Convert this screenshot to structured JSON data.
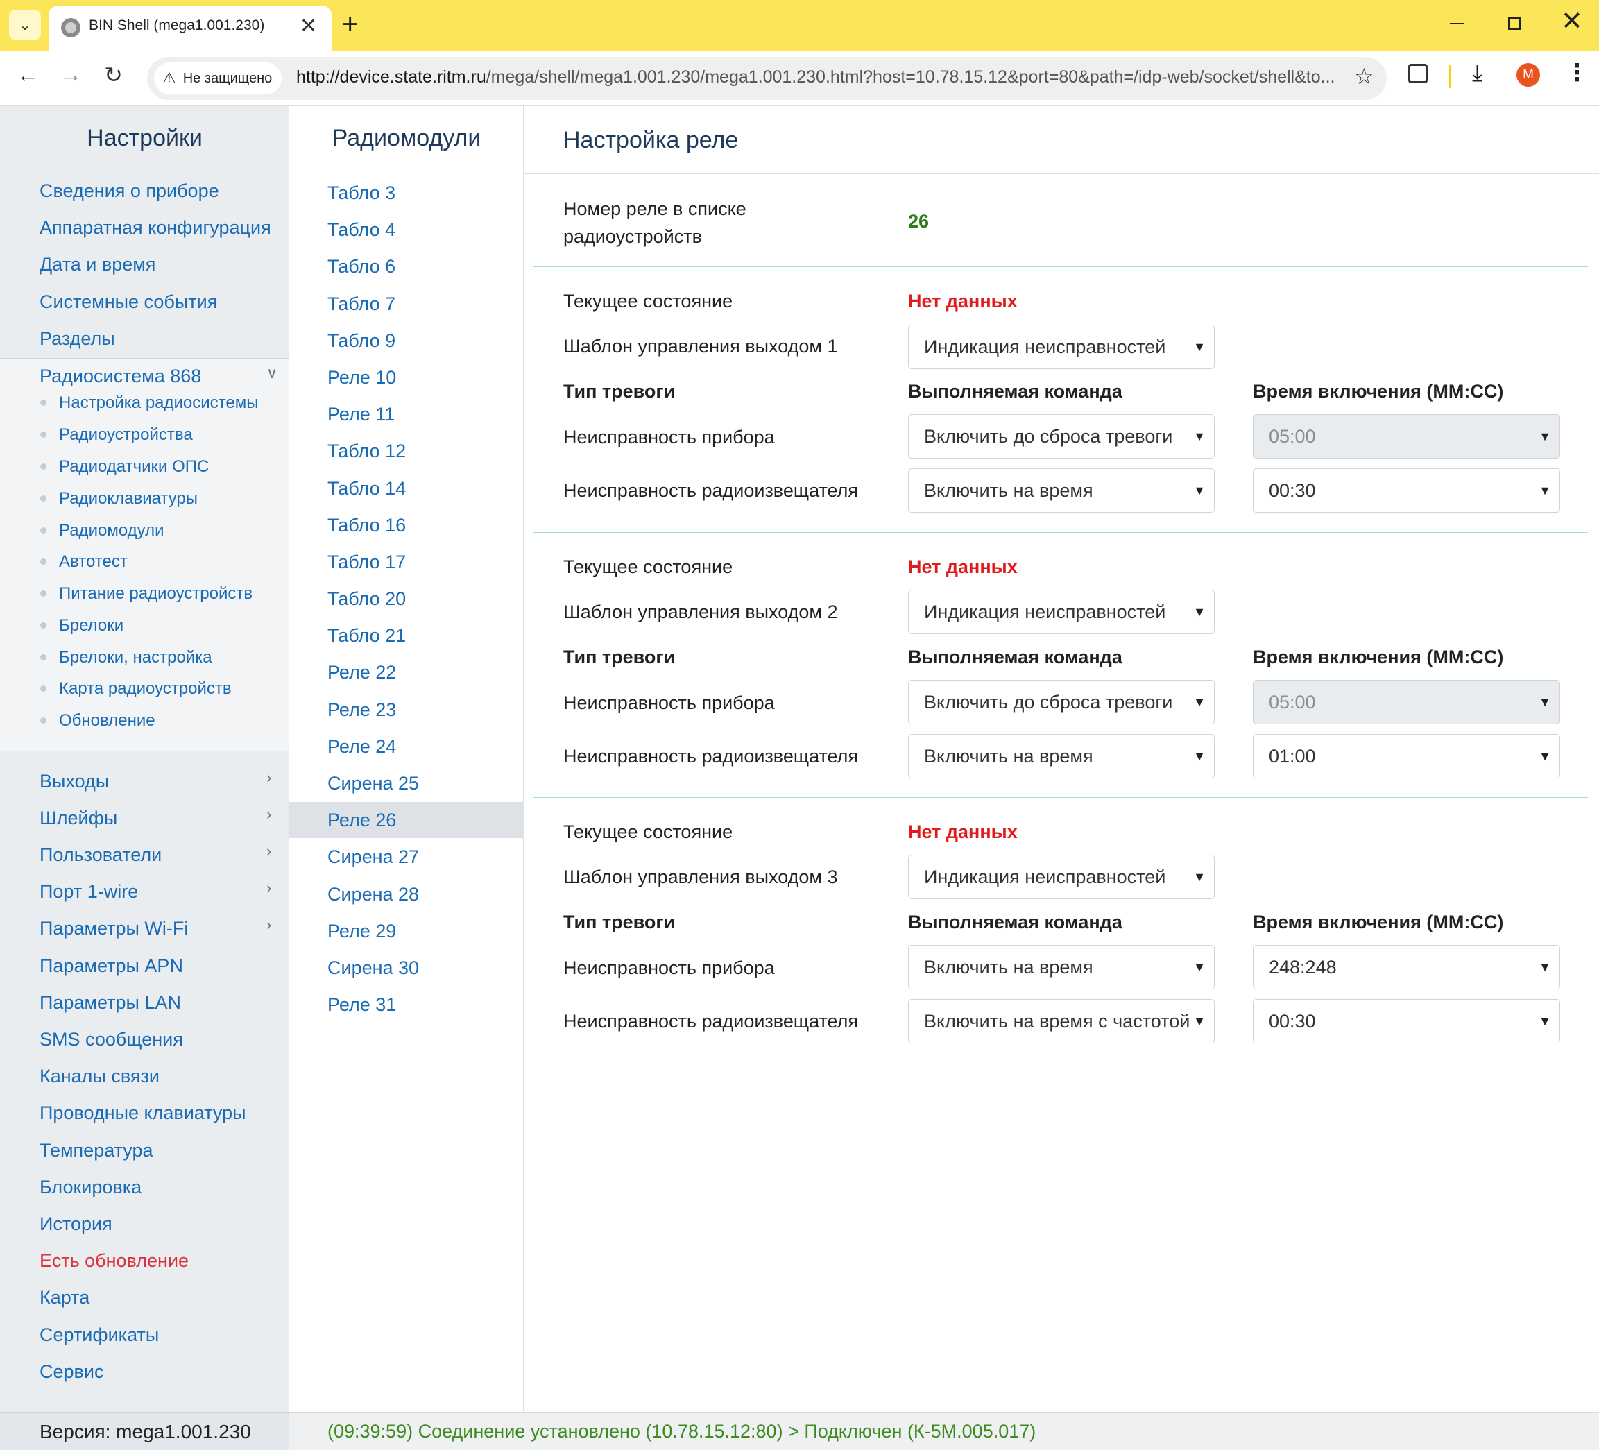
{
  "browser": {
    "tab_title": "BIN Shell (mega1.001.230)",
    "security_label": "Не защищено",
    "url_host": "http://device.state.ritm.ru",
    "url_path": "/mega/shell/mega1.001.230/mega1.001.230.html?host=10.78.15.12&port=80&path=/idp-web/socket/shell&to...",
    "profile_initial": "M",
    "accent_color": "#fde55a"
  },
  "sidebar": {
    "title": "Настройки",
    "top_items": [
      "Сведения о приборе",
      "Аппаратная конфигурация",
      "Дата и время",
      "Системные события",
      "Разделы"
    ],
    "radio_group": {
      "label": "Радиосистема 868",
      "subitems": [
        "Настройка радиосистемы",
        "Радиоустройства",
        "Радиодатчики ОПС",
        "Радиоклавиатуры",
        "Радиомодули",
        "Автотест",
        "Питание радиоустройств",
        "Брелоки",
        "Брелоки, настройка",
        "Карта радиоустройств",
        "Обновление"
      ]
    },
    "expandable_items": [
      "Выходы",
      "Шлейфы",
      "Пользователи",
      "Порт 1-wire",
      "Параметры Wi-Fi"
    ],
    "bottom_items": [
      "Параметры APN",
      "Параметры LAN",
      "SMS сообщения",
      "Каналы связи",
      "Проводные клавиатуры",
      "Температура",
      "Блокировка",
      "История",
      "Есть обновление",
      "Карта",
      "Сертификаты",
      "Сервис"
    ],
    "version": "Версия: mega1.001.230"
  },
  "radiomodules": {
    "title": "Радиомодули",
    "items": [
      "Табло 3",
      "Табло 4",
      "Табло 6",
      "Табло 7",
      "Табло 9",
      "Реле 10",
      "Реле 11",
      "Табло 12",
      "Табло 14",
      "Табло 16",
      "Табло 17",
      "Табло 20",
      "Табло 21",
      "Реле 22",
      "Реле 23",
      "Реле 24",
      "Сирена 25",
      "Реле 26",
      "Сирена 27",
      "Сирена 28",
      "Реле 29",
      "Сирена 30",
      "Реле 31"
    ],
    "active": "Реле 26"
  },
  "main": {
    "title": "Настройка реле",
    "relay_number_label": "Номер реле в списке радиоустройств",
    "relay_number": "26",
    "outputs": [
      {
        "state_label": "Текущее состояние",
        "state_value": "Нет данных",
        "template_label": "Шаблон управления выходом 1",
        "template_value": "Индикация неисправностей",
        "col_alarm": "Тип тревоги",
        "col_command": "Выполняемая команда",
        "col_time": "Время включения (ММ:СС)",
        "rows": [
          {
            "alarm": "Неисправность прибора",
            "command": "Включить до сброса тревоги",
            "time": "05:00",
            "time_disabled": true
          },
          {
            "alarm": "Неисправность радиоизвещателя",
            "command": "Включить на время",
            "time": "00:30",
            "time_disabled": false
          }
        ]
      },
      {
        "state_label": "Текущее состояние",
        "state_value": "Нет данных",
        "template_label": "Шаблон управления выходом 2",
        "template_value": "Индикация неисправностей",
        "col_alarm": "Тип тревоги",
        "col_command": "Выполняемая команда",
        "col_time": "Время включения (ММ:СС)",
        "rows": [
          {
            "alarm": "Неисправность прибора",
            "command": "Включить до сброса тревоги",
            "time": "05:00",
            "time_disabled": true
          },
          {
            "alarm": "Неисправность радиоизвещателя",
            "command": "Включить на время",
            "time": "01:00",
            "time_disabled": false
          }
        ]
      },
      {
        "state_label": "Текущее состояние",
        "state_value": "Нет данных",
        "template_label": "Шаблон управления выходом 3",
        "template_value": "Индикация неисправностей",
        "col_alarm": "Тип тревоги",
        "col_command": "Выполняемая команда",
        "col_time": "Время включения (ММ:СС)",
        "rows": [
          {
            "alarm": "Неисправность прибора",
            "command": "Включить на время",
            "time": "248:248",
            "time_disabled": false
          },
          {
            "alarm": "Неисправность радиоизвещателя",
            "command": "Включить на время с частотой",
            "time": "00:30",
            "time_disabled": false
          }
        ]
      }
    ]
  },
  "status": {
    "text": "(09:39:59) Соединение установлено (10.78.15.12:80) > Подключен (К-5М.005.017)",
    "color": "#3d8b1f"
  }
}
